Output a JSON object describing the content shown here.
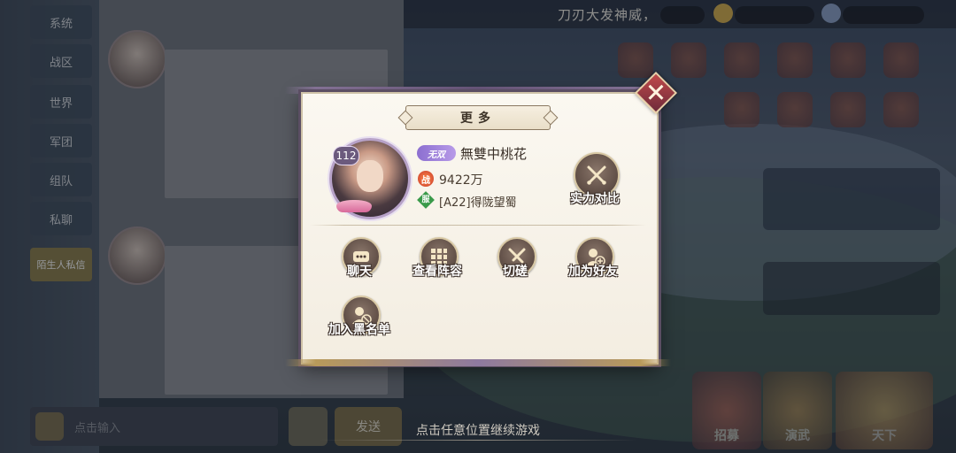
{
  "background": {
    "chat_tabs": [
      "系统",
      "战区",
      "世界",
      "军团",
      "组队",
      "私聊",
      "陌生人私信"
    ],
    "bottom_input_placeholder": "点击输入",
    "send_label": "发送",
    "top_banner": "刀刃大发神威，",
    "bottom_nav": [
      "招募",
      "演武",
      "天下"
    ]
  },
  "dialog": {
    "title": "更多",
    "player": {
      "level": "112",
      "vip": "无双",
      "name": "無雙中桃花",
      "power_icon": "战",
      "power": "9422万",
      "server_icon": "服",
      "server": "[A22]得陇望蜀"
    },
    "compare_label": "实力对比",
    "actions": [
      {
        "label": "聊天",
        "icon": "chat-icon"
      },
      {
        "label": "查看阵容",
        "icon": "grid-icon"
      },
      {
        "label": "切磋",
        "icon": "swords-icon"
      },
      {
        "label": "加为好友",
        "icon": "add-friend-icon"
      },
      {
        "label": "加入黑名单",
        "icon": "block-user-icon"
      }
    ]
  },
  "hint": "点击任意位置继续游戏"
}
